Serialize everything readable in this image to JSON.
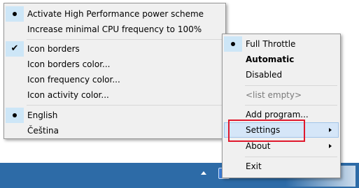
{
  "settings_menu": {
    "items": [
      {
        "label": "Activate High Performance power scheme",
        "mark": "dot"
      },
      {
        "label": "Increase minimal CPU frequency to 100%",
        "mark": ""
      },
      {
        "label": "Icon borders",
        "mark": "check"
      },
      {
        "label": "Icon borders color...",
        "mark": ""
      },
      {
        "label": "Icon frequency color...",
        "mark": ""
      },
      {
        "label": "Icon activity color...",
        "mark": ""
      },
      {
        "label": "English",
        "mark": "dot"
      },
      {
        "label": "Čeština",
        "mark": ""
      }
    ]
  },
  "context_menu": {
    "items": [
      {
        "label": "Full Throttle",
        "mark": "dot"
      },
      {
        "label": "Automatic",
        "style": "bold"
      },
      {
        "label": "Disabled"
      },
      {
        "label": "<list empty>",
        "style": "disabled"
      },
      {
        "label": "Add program..."
      },
      {
        "label": "Settings",
        "submenu": true,
        "state": "highlighted"
      },
      {
        "label": "About",
        "submenu": true
      },
      {
        "label": "Exit"
      }
    ]
  },
  "colors": {
    "menu_background": "#f0f0f0",
    "check_background": "#cde6f7",
    "hover_background": "#d5e6f8",
    "annotation_border": "#e0182c",
    "taskbar": "#2d6ba7"
  },
  "icons": {
    "tray_overflow": "chevron-up-icon",
    "radio": "dot-icon",
    "check": "checkmark-icon",
    "submenu": "triangle-right-icon"
  }
}
